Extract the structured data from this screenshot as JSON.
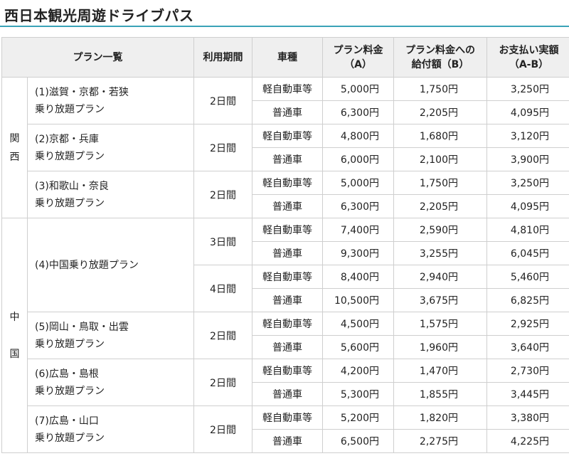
{
  "title": "西日本観光周遊ドライブパス",
  "header": {
    "plan": "プラン一覧",
    "period": "利用期間",
    "car": "車種",
    "price_a_l1": "プラン料金",
    "price_a_l2": "（A）",
    "benefit_l1": "プラン料金への",
    "benefit_l2": "給付額（B）",
    "pay_l1": "お支払い実額",
    "pay_l2": "（A-B）"
  },
  "regions": {
    "kansai_1": "関",
    "kansai_2": "西",
    "chugoku_1": "中",
    "chugoku_2": "国"
  },
  "plans": [
    {
      "l1": "(1)滋賀・京都・若狭",
      "l2": "乗り放題プラン",
      "days": "2日間",
      "rows": [
        {
          "car": "軽自動車等",
          "a": "5,000円",
          "b": "1,750円",
          "ab": "3,250円"
        },
        {
          "car": "普通車",
          "a": "6,300円",
          "b": "2,205円",
          "ab": "4,095円"
        }
      ]
    },
    {
      "l1": "(2)京都・兵庫",
      "l2": "乗り放題プラン",
      "days": "2日間",
      "rows": [
        {
          "car": "軽自動車等",
          "a": "4,800円",
          "b": "1,680円",
          "ab": "3,120円"
        },
        {
          "car": "普通車",
          "a": "6,000円",
          "b": "2,100円",
          "ab": "3,900円"
        }
      ]
    },
    {
      "l1": "(3)和歌山・奈良",
      "l2": "乗り放題プラン",
      "days": "2日間",
      "rows": [
        {
          "car": "軽自動車等",
          "a": "5,000円",
          "b": "1,750円",
          "ab": "3,250円"
        },
        {
          "car": "普通車",
          "a": "6,300円",
          "b": "2,205円",
          "ab": "4,095円"
        }
      ]
    },
    {
      "l1": "(4)中国乗り放題プラン",
      "days3": "3日間",
      "days4": "4日間",
      "rows": [
        {
          "car": "軽自動車等",
          "a": "7,400円",
          "b": "2,590円",
          "ab": "4,810円"
        },
        {
          "car": "普通車",
          "a": "9,300円",
          "b": "3,255円",
          "ab": "6,045円"
        },
        {
          "car": "軽自動車等",
          "a": "8,400円",
          "b": "2,940円",
          "ab": "5,460円"
        },
        {
          "car": "普通車",
          "a": "10,500円",
          "b": "3,675円",
          "ab": "6,825円"
        }
      ]
    },
    {
      "l1": "(5)岡山・鳥取・出雲",
      "l2": "乗り放題プラン",
      "days": "2日間",
      "rows": [
        {
          "car": "軽自動車等",
          "a": "4,500円",
          "b": "1,575円",
          "ab": "2,925円"
        },
        {
          "car": "普通車",
          "a": "5,600円",
          "b": "1,960円",
          "ab": "3,640円"
        }
      ]
    },
    {
      "l1": "(6)広島・島根",
      "l2": "乗り放題プラン",
      "days": "2日間",
      "rows": [
        {
          "car": "軽自動車等",
          "a": "4,200円",
          "b": "1,470円",
          "ab": "2,730円"
        },
        {
          "car": "普通車",
          "a": "5,300円",
          "b": "1,855円",
          "ab": "3,445円"
        }
      ]
    },
    {
      "l1": "(7)広島・山口",
      "l2": "乗り放題プラン",
      "days": "2日間",
      "rows": [
        {
          "car": "軽自動車等",
          "a": "5,200円",
          "b": "1,820円",
          "ab": "3,380円"
        },
        {
          "car": "普通車",
          "a": "6,500円",
          "b": "2,275円",
          "ab": "4,225円"
        }
      ]
    }
  ]
}
